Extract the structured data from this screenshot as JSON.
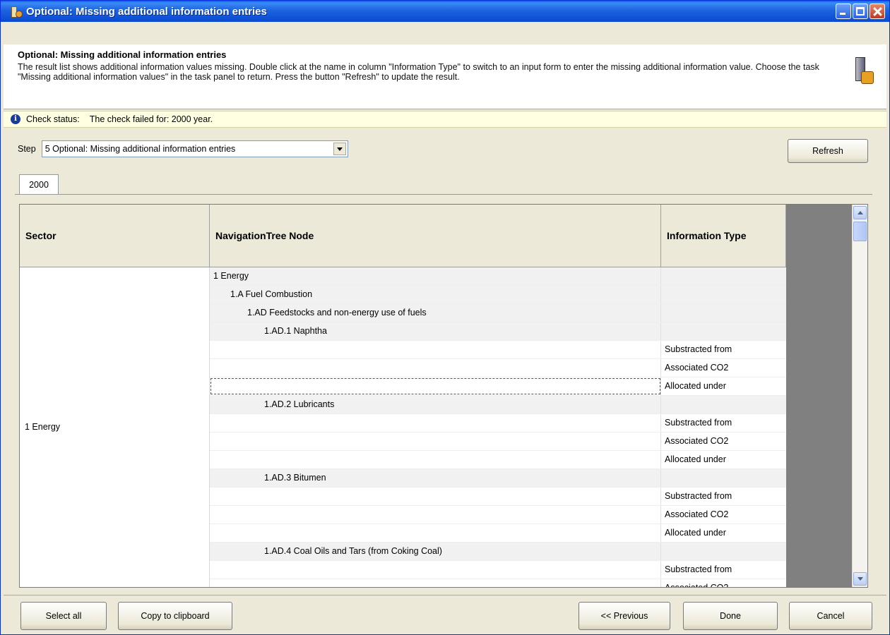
{
  "window": {
    "title": "Optional: Missing additional information entries"
  },
  "header": {
    "title": "Optional: Missing additional information entries",
    "description": "The result list shows additional information values missing. Double click at the name in column \"Information Type\" to switch to an input form to enter the missing additional information value. Choose the task \"Missing additional information values\" in the task panel to return. Press the button \"Refresh\" to update the result."
  },
  "status": {
    "label": "Check status:",
    "message": "The check failed for: 2000 year."
  },
  "step": {
    "label": "Step",
    "selected": "5 Optional: Missing additional information entries"
  },
  "buttons": {
    "refresh": "Refresh",
    "select_all": "Select all",
    "copy": "Copy to clipboard",
    "previous": "<< Previous",
    "done": "Done",
    "cancel": "Cancel"
  },
  "tabs": [
    {
      "label": "2000"
    }
  ],
  "grid": {
    "columns": [
      "Sector",
      "NavigationTree Node",
      "Information Type"
    ],
    "sector": "1 Energy",
    "rows": [
      {
        "level": 0,
        "node": "1 Energy",
        "info": ""
      },
      {
        "level": 1,
        "node": "1.A Fuel Combustion",
        "info": ""
      },
      {
        "level": 2,
        "node": "1.AD Feedstocks and non-energy use of fuels",
        "info": ""
      },
      {
        "level": 3,
        "node": "1.AD.1 Naphtha",
        "info": ""
      },
      {
        "level": -1,
        "node": "",
        "info": "Substracted from"
      },
      {
        "level": -1,
        "node": "",
        "info": "Associated CO2"
      },
      {
        "level": -1,
        "node": "",
        "info": "Allocated under",
        "selected": true
      },
      {
        "level": 3,
        "node": "1.AD.2 Lubricants",
        "info": ""
      },
      {
        "level": -1,
        "node": "",
        "info": "Substracted from"
      },
      {
        "level": -1,
        "node": "",
        "info": "Associated CO2"
      },
      {
        "level": -1,
        "node": "",
        "info": "Allocated under"
      },
      {
        "level": 3,
        "node": "1.AD.3 Bitumen",
        "info": ""
      },
      {
        "level": -1,
        "node": "",
        "info": "Substracted from"
      },
      {
        "level": -1,
        "node": "",
        "info": "Associated CO2"
      },
      {
        "level": -1,
        "node": "",
        "info": "Allocated under"
      },
      {
        "level": 3,
        "node": "1.AD.4 Coal Oils and Tars (from Coking Coal)",
        "info": ""
      },
      {
        "level": -1,
        "node": "",
        "info": "Substracted from"
      },
      {
        "level": -1,
        "node": "",
        "info": "Associated CO2"
      }
    ]
  },
  "icons": {
    "app": "app-icon",
    "wizard": "wizard-icon",
    "info": "info-icon"
  },
  "colors": {
    "titlebar": "#0a5ae8",
    "status_bg": "#ffffe1",
    "grid_empty": "#808080"
  }
}
